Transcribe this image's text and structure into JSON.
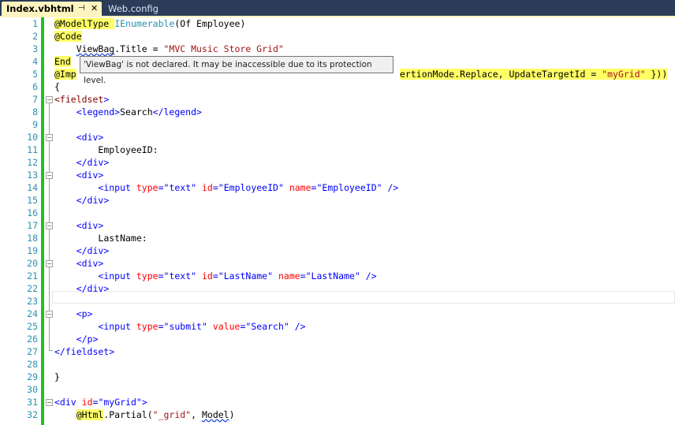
{
  "tabs": {
    "active": {
      "label": "Index.vbhtml",
      "pin_glyph": "⊣",
      "close_glyph": "✕"
    },
    "other": {
      "label": "Web.config"
    }
  },
  "tooltip": {
    "text": "'ViewBag' is not declared. It may be inaccessible due to its protection level."
  },
  "line_numbers": [
    "1",
    "2",
    "3",
    "4",
    "5",
    "6",
    "7",
    "8",
    "9",
    "10",
    "11",
    "12",
    "13",
    "14",
    "15",
    "16",
    "17",
    "18",
    "19",
    "20",
    "21",
    "22",
    "23",
    "24",
    "25",
    "26",
    "27",
    "28",
    "29",
    "30",
    "31",
    "32"
  ],
  "code": {
    "l1_a": "@ModelType",
    "l1_b": "IEnumerable",
    "l1_c": "(Of Employee)",
    "l2": "@Code",
    "l3_a": "ViewBag",
    "l3_b": ".Title = ",
    "l3_c": "\"MVC Music Store Grid\"",
    "l4": "End",
    "l5_a": "@Imp",
    "l5_b": "ertionMode.Replace, UpdateTargetId = ",
    "l5_c": "\"myGrid\"",
    "l5_d": " }))",
    "l6": "{",
    "l7_a": "<fieldset",
    "l7_b": ">",
    "l8_a": "<legend>",
    "l8_b": "Search",
    "l8_c": "</legend>",
    "l10": "<div>",
    "l11": "EmployeeID:",
    "l12": "</div>",
    "l13": "<div>",
    "l14_tag": "<input",
    "l14_a1": "type",
    "l14_v1": "\"text\"",
    "l14_a2": "id",
    "l14_v2": "\"EmployeeID\"",
    "l14_a3": "name",
    "l14_v3": "\"EmployeeID\"",
    "l14_end": " />",
    "l15": "</div>",
    "l17": "<div>",
    "l18": "LastName:",
    "l19": "</div>",
    "l20": "<div>",
    "l21_v1": "\"text\"",
    "l21_v2": "\"LastName\"",
    "l21_v3": "\"LastName\"",
    "l22": "</div>",
    "l24": "<p>",
    "l25_v1": "\"submit\"",
    "l25_a2": "value",
    "l25_v2": "\"Search\"",
    "l26": "</p>",
    "l27": "</fieldset>",
    "l29": "}",
    "l31_a": "<div",
    "l31_b": "id",
    "l31_c": "\"myGrid\"",
    "l31_d": ">",
    "l32_a": "@Html",
    "l32_b": ".Partial(",
    "l32_c": "\"_grid\"",
    "l32_d": ", ",
    "l32_e": "Model",
    "l32_f": ")",
    "eq": "="
  }
}
